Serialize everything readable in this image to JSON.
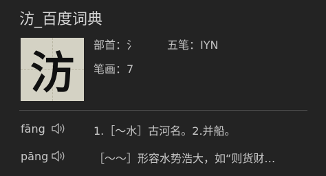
{
  "page": {
    "title": "汸_百度词典"
  },
  "character": {
    "glyph": "汸",
    "radical_text": "部首：氵",
    "wubi_text": "五笔：IYN",
    "strokes_text": "笔画：7"
  },
  "pronunciations": [
    {
      "pinyin": "fāng",
      "speaker_icon": "speaker-icon",
      "definition": "1.［～水］古河名。2.并船。"
    },
    {
      "pinyin": "pāng",
      "speaker_icon": "speaker-icon",
      "definition": "［～～］形容水势浩大，如“则货财…"
    }
  ],
  "colors": {
    "background": "#232323",
    "text": "#c8c8c8",
    "char_box_bg": "#d4d2c4",
    "divider": "#4a4a4a"
  }
}
